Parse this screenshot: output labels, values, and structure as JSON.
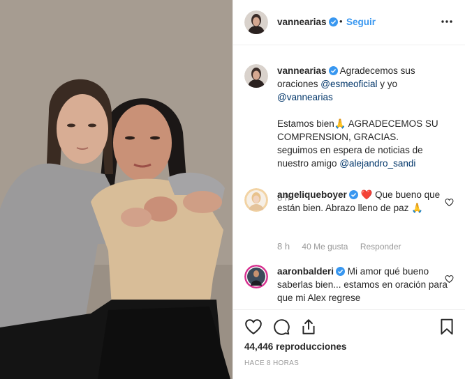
{
  "header": {
    "username": "vannearias",
    "separator": "•",
    "follow_label": "Seguir"
  },
  "caption": {
    "username": "vannearias",
    "line1_pre": "Agradecemos sus oraciones ",
    "mention1": "@esmeoficial",
    "line1_mid": " y yo ",
    "mention2": "@vannearias",
    "para2": "Estamos bien🙏 AGRADECEMOS SU COMPRENSION, GRACIAS.",
    "para3_pre": "seguimos en espera de noticias de nuestro amigo ",
    "mention3": "@alejandro_sandi",
    "time": "8 h"
  },
  "comments": [
    {
      "username": "angeliqueboyer",
      "text": " ❤️ Que bueno que están bien. Abrazo lleno de paz 🙏",
      "time": "8 h",
      "likes": "40 Me gusta",
      "reply_label": "Responder"
    },
    {
      "username": "aaronbalderi",
      "text": " Mi amor qué bueno saberlas bien... estamos en oración para que mi Alex regrese"
    }
  ],
  "footer": {
    "views_count": "44,446",
    "views_label": "reproducciones",
    "posted_ago": "HACE 8 HORAS"
  },
  "colors": {
    "accent": "#3897f0",
    "mention": "#003569",
    "muted": "#999999",
    "border": "#efefef"
  },
  "icons": [
    "verified-badge-icon",
    "more-options-icon",
    "heart-icon",
    "comment-icon",
    "share-icon",
    "bookmark-icon"
  ]
}
